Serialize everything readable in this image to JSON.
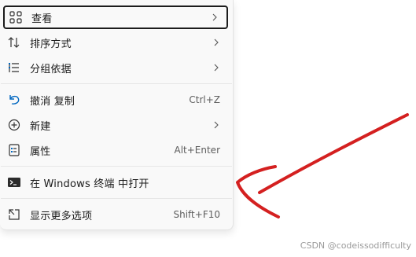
{
  "menu": {
    "view": {
      "label": "查看",
      "icon": "grid-view-icon"
    },
    "sort": {
      "label": "排序方式",
      "icon": "sort-arrows-icon"
    },
    "group": {
      "label": "分组依据",
      "icon": "group-list-icon"
    },
    "undo": {
      "label": "撤消 复制",
      "shortcut": "Ctrl+Z",
      "icon": "undo-icon"
    },
    "new": {
      "label": "新建",
      "icon": "add-circle-icon"
    },
    "properties": {
      "label": "属性",
      "shortcut": "Alt+Enter",
      "icon": "properties-icon"
    },
    "terminal": {
      "label": "在 Windows 终端 中打开",
      "icon": "terminal-icon"
    },
    "more": {
      "label": "显示更多选项",
      "shortcut": "Shift+F10",
      "icon": "more-options-icon"
    }
  },
  "annotation": {
    "arrow_color": "#d42020"
  },
  "watermark": "CSDN @codeissodifficulty"
}
